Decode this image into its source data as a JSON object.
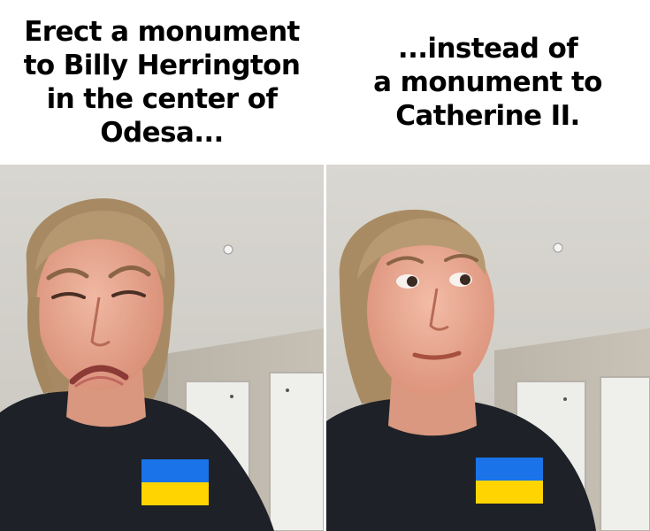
{
  "panels": [
    {
      "caption_lines": [
        "Erect a monument",
        "to Billy Herrington",
        "in the center of",
        "Odesa..."
      ],
      "expression": "disgust"
    },
    {
      "caption_lines": [
        "...instead of",
        "a monument to",
        "Catherine II."
      ],
      "expression": "approval"
    }
  ],
  "flag": {
    "top_color": "#1a73e8",
    "bottom_color": "#ffd400"
  }
}
